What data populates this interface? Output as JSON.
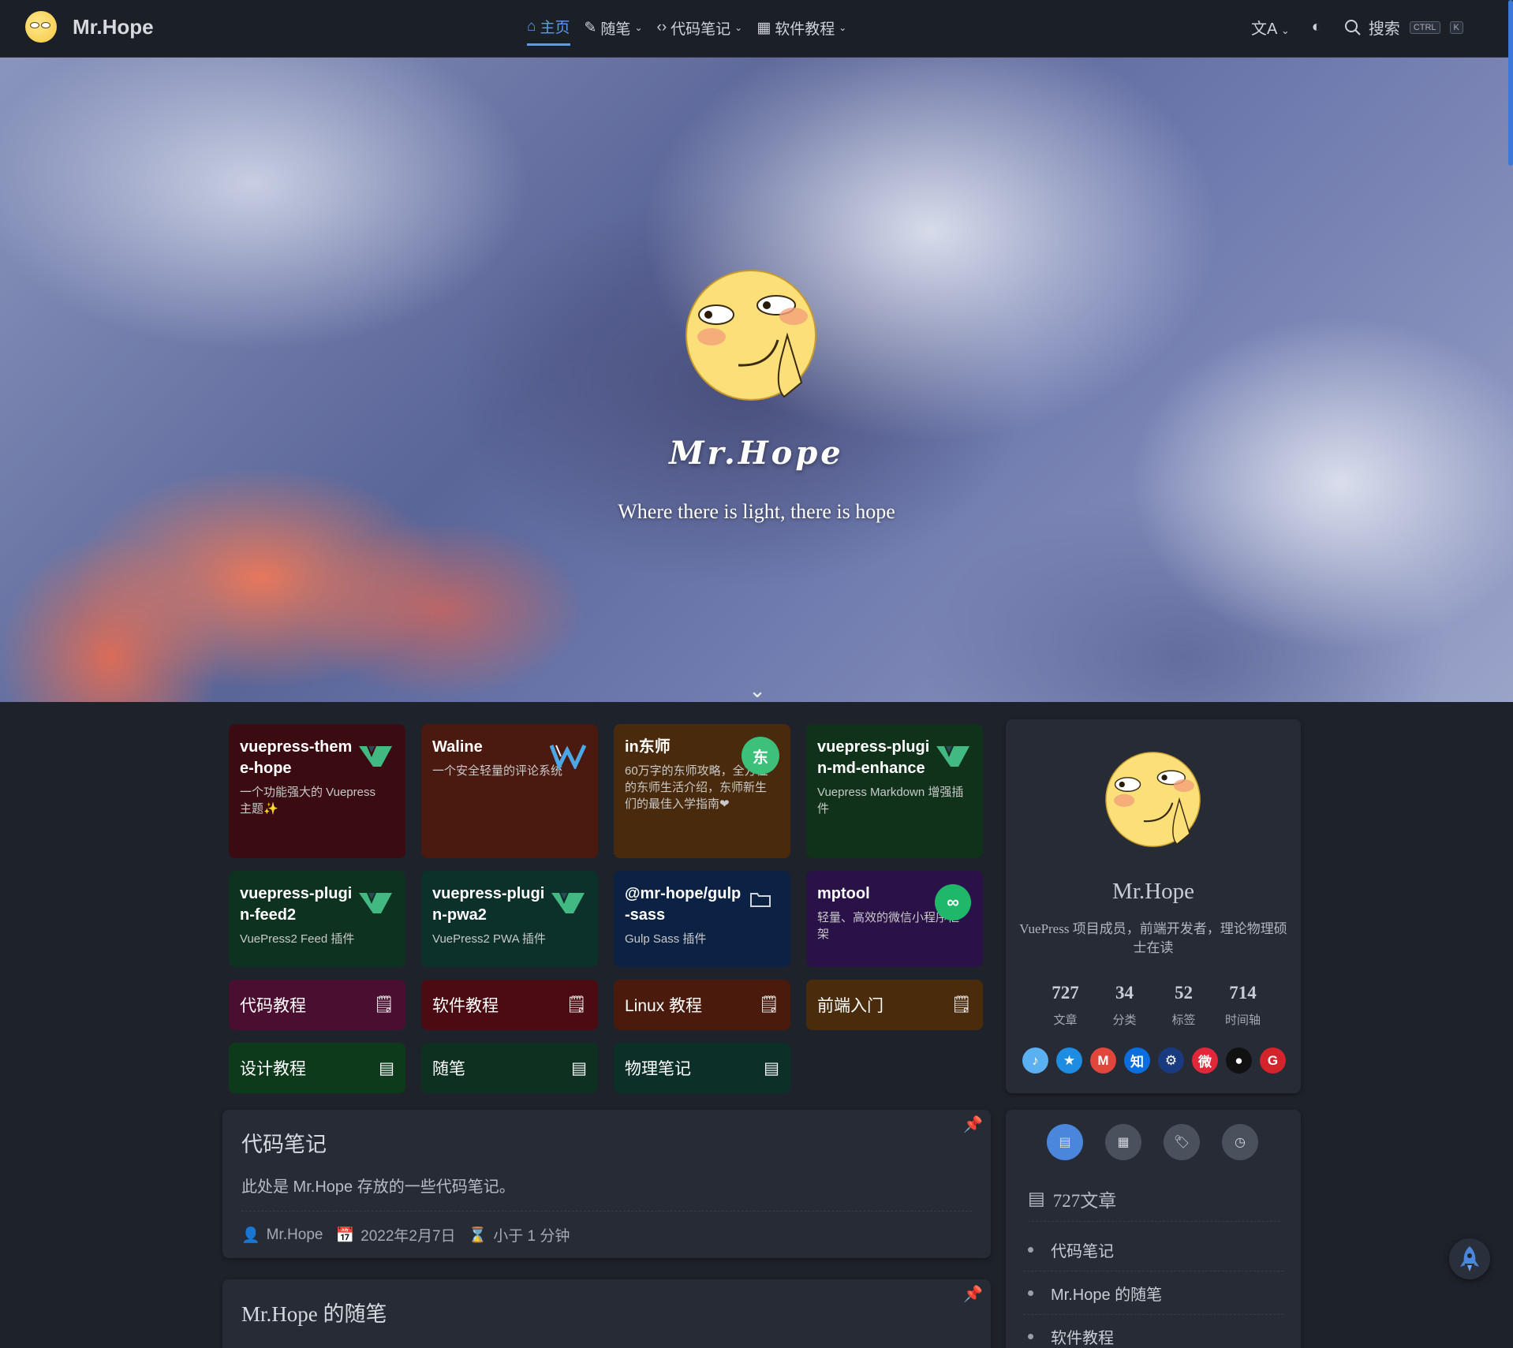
{
  "navbar": {
    "brand": "Mr.Hope",
    "links": [
      {
        "label": "主页",
        "icon": "home-icon",
        "active": true
      },
      {
        "label": "随笔",
        "icon": "notes-icon",
        "dropdown": true
      },
      {
        "label": "代码笔记",
        "icon": "code-icon",
        "dropdown": true
      },
      {
        "label": "软件教程",
        "icon": "software-icon",
        "dropdown": true
      }
    ],
    "search_label": "搜索",
    "kbd_ctrl": "CTRL",
    "kbd_k": "K"
  },
  "hero": {
    "title": "Mr.Hope",
    "tagline": "Where there is light, there is hope"
  },
  "projects": [
    {
      "title": "vuepress-theme-hope",
      "desc": "一个功能强大的 Vuepress 主题✨",
      "icon": "vuepress-logo-icon",
      "bg": "#3a0c12"
    },
    {
      "title": "Waline",
      "desc": "一个安全轻量的评论系统",
      "icon": "waline-logo-icon",
      "bg": "#4a1a10"
    },
    {
      "title": "in东师",
      "desc": "60万字的东师攻略，全方位的东师生活介绍，东师新生们的最佳入学指南❤",
      "icon": "indongshi-logo-icon",
      "bg": "#4a2a0c"
    },
    {
      "title": "vuepress-plugin-md-enhance",
      "desc": "Vuepress Markdown 增强插件",
      "icon": "vuepress-logo-icon",
      "bg": "#10321a"
    },
    {
      "title": "vuepress-plugin-feed2",
      "desc": "VuePress2 Feed 插件",
      "icon": "vuepress-logo-icon",
      "bg": "#0e3220"
    },
    {
      "title": "vuepress-plugin-pwa2",
      "desc": "VuePress2 PWA 插件",
      "icon": "vuepress-logo-icon",
      "bg": "#0c302a"
    },
    {
      "title": "@mr-hope/gulp-sass",
      "desc": "Gulp Sass 插件",
      "icon": "folder-icon",
      "bg": "#0c2244"
    },
    {
      "title": "mptool",
      "desc": "轻量、高效的微信小程序框架",
      "icon": "miniprogram-logo-icon",
      "bg": "#2a1248"
    }
  ],
  "books": [
    {
      "label": "代码教程",
      "icon": "book-icon",
      "bg": "#4a0e30"
    },
    {
      "label": "软件教程",
      "icon": "book-icon",
      "bg": "#4a0c12"
    },
    {
      "label": "Linux 教程",
      "icon": "book-icon",
      "bg": "#4a1a0c"
    },
    {
      "label": "前端入门",
      "icon": "book-icon",
      "bg": "#4a2c0c"
    },
    {
      "label": "设计教程",
      "icon": "article-icon",
      "bg": "#0e3a1c"
    },
    {
      "label": "随笔",
      "icon": "article-icon",
      "bg": "#0e3020"
    },
    {
      "label": "物理笔记",
      "icon": "article-icon",
      "bg": "#0c3028"
    }
  ],
  "articles": [
    {
      "title": "代码笔记",
      "excerpt": "此处是 Mr.Hope 存放的一些代码笔记。",
      "author": "Mr.Hope",
      "date": "2022年2月7日",
      "reading_time": "小于 1 分钟",
      "pinned": true
    },
    {
      "title": "Mr.Hope 的随笔",
      "pinned": true
    }
  ],
  "profile": {
    "name": "Mr.Hope",
    "desc": "VuePress 项目成员，前端开发者，理论物理硕士在读",
    "stats": [
      {
        "num": "727",
        "label": "文章"
      },
      {
        "num": "34",
        "label": "分类"
      },
      {
        "num": "52",
        "label": "标签"
      },
      {
        "num": "714",
        "label": "时间轴"
      }
    ],
    "socials": [
      {
        "name": "qq-icon",
        "color": "#5ab0f0",
        "glyph": "🔔"
      },
      {
        "name": "qzone-icon",
        "color": "#1e8ce0",
        "glyph": "★"
      },
      {
        "name": "gmail-icon",
        "color": "#e0463c",
        "glyph": "M"
      },
      {
        "name": "zhihu-icon",
        "color": "#0a6ee0",
        "glyph": "知"
      },
      {
        "name": "steam-icon",
        "color": "#1a3a80",
        "glyph": "⚙"
      },
      {
        "name": "weibo-icon",
        "color": "#e0283a",
        "glyph": "微"
      },
      {
        "name": "github-icon",
        "color": "#111111",
        "glyph": "●"
      },
      {
        "name": "gitee-icon",
        "color": "#d4232a",
        "glyph": "G"
      }
    ]
  },
  "info_panel": {
    "article_count": "727文章",
    "items": [
      "代码笔记",
      "Mr.Hope 的随笔",
      "软件教程"
    ]
  }
}
